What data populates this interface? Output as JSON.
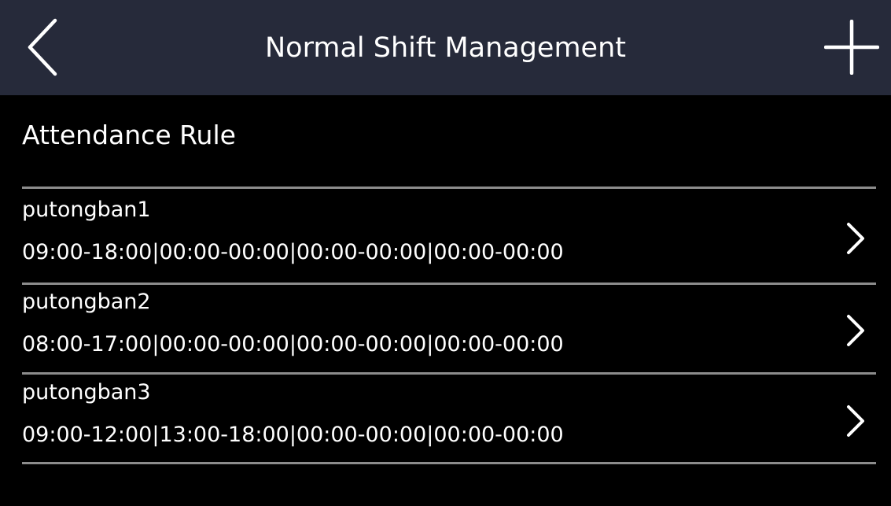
{
  "header": {
    "title": "Normal Shift Management"
  },
  "section": {
    "title": "Attendance Rule"
  },
  "rules": [
    {
      "name": "putongban1",
      "times": "09:00-18:00|00:00-00:00|00:00-00:00|00:00-00:00"
    },
    {
      "name": "putongban2",
      "times": "08:00-17:00|00:00-00:00|00:00-00:00|00:00-00:00"
    },
    {
      "name": "putongban3",
      "times": "09:00-12:00|13:00-18:00|00:00-00:00|00:00-00:00"
    }
  ],
  "icons": {
    "back": "back-chevron-icon",
    "add": "plus-icon",
    "row": "chevron-right-icon"
  },
  "colors": {
    "header_bg": "#262a3a",
    "background": "#000000",
    "text": "#ffffff",
    "divider": "#8c8c8c"
  }
}
